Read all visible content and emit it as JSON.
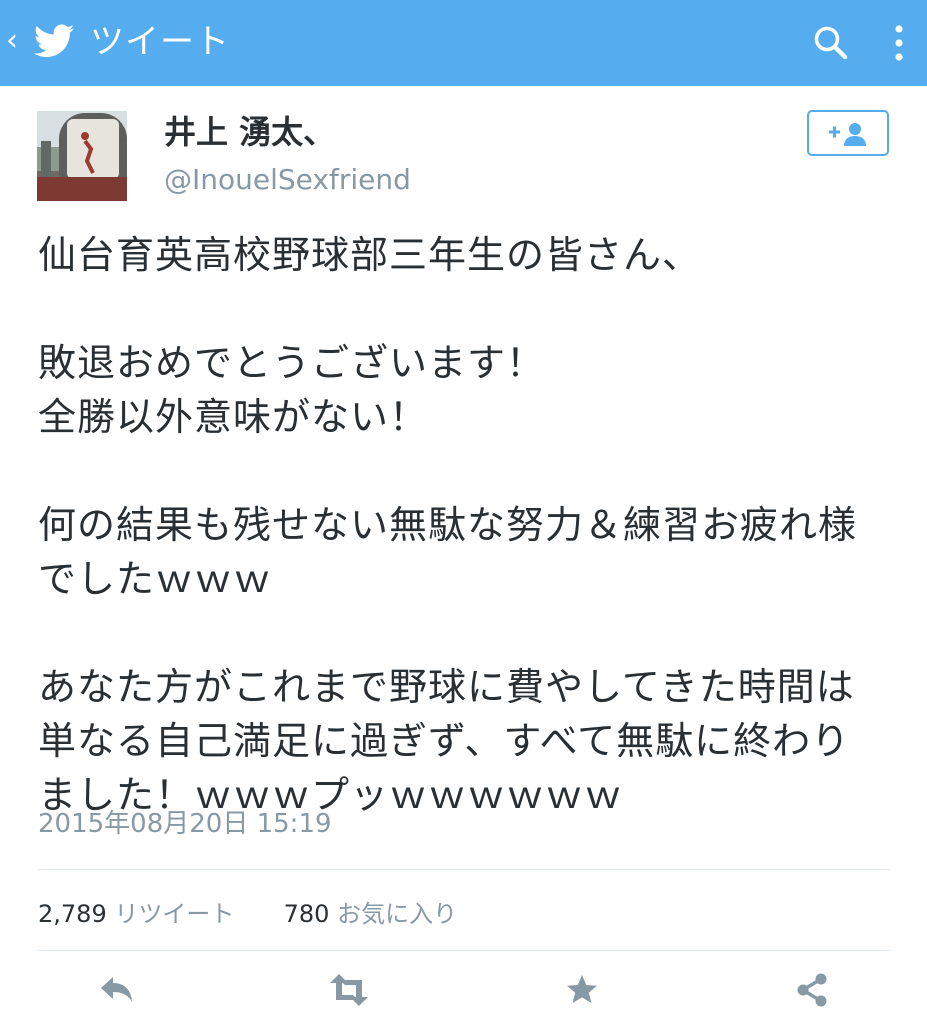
{
  "header": {
    "title": "ツイート",
    "back_icon": "back-chevron-icon",
    "logo_icon": "twitter-bird-icon",
    "search_icon": "search-icon",
    "more_icon": "more-vertical-icon",
    "background_color": "#55acee"
  },
  "user": {
    "name": "井上 湧太、",
    "handle": "@InouelSexfriend",
    "follow_icon": "add-user-icon"
  },
  "tweet": {
    "paragraphs": [
      "仙台育英高校野球部三年生の皆さん、",
      "敗退おめでとうございます！\n全勝以外意味がない！",
      "何の結果も残せない無駄な努力＆練習お疲れ様\nでしたｗｗｗ",
      "あなた方がこれまで野球に費やしてきた時間は\n単なる自己満足に過ぎず、すべて無駄に終わり\nました！ｗｗｗプッｗｗｗｗｗｗ"
    ],
    "timestamp": "2015年08月20日 15:19"
  },
  "stats": {
    "retweet_count": "2,789",
    "retweet_label": "リツイート",
    "favorite_count": "780",
    "favorite_label": "お気に入り"
  },
  "actions": {
    "reply_icon": "reply-icon",
    "retweet_icon": "retweet-icon",
    "favorite_icon": "star-icon",
    "share_icon": "share-icon"
  },
  "colors": {
    "accent": "#55acee",
    "text": "#292f33",
    "muted": "#8899a6",
    "icon_gray": "#8899a6"
  }
}
